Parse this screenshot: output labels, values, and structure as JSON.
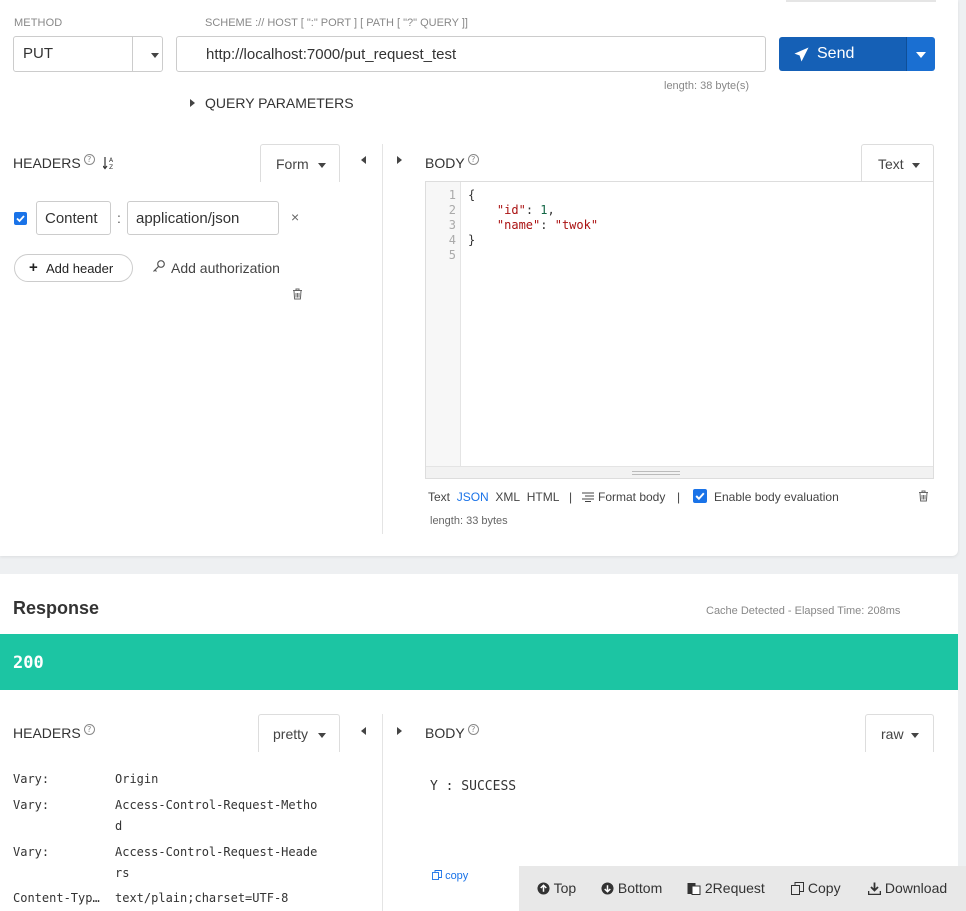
{
  "request": {
    "method_label": "METHOD",
    "method_value": "PUT",
    "scheme_label": "SCHEME :// HOST [ \":\" PORT ] [ PATH [ \"?\" QUERY ]]",
    "url": "http://localhost:7000/put_request_test",
    "url_length": "length: 38 byte(s)",
    "send_label": "Send",
    "query_params_label": "QUERY PARAMETERS",
    "headers": {
      "title": "HEADERS",
      "mode": "Form",
      "rows": [
        {
          "enabled": true,
          "name": "Content",
          "value": "application/json"
        }
      ],
      "add_header_label": "Add header",
      "add_authorization_label": "Add authorization"
    },
    "body": {
      "title": "BODY",
      "mode": "Text",
      "lines": [
        "{",
        "    \"id\": 1,",
        "    \"name\": \"twok\"",
        "}",
        ""
      ],
      "formats": [
        "Text",
        "JSON",
        "XML",
        "HTML"
      ],
      "active_format": "JSON",
      "format_body_label": "Format body",
      "enable_eval_label": "Enable body evaluation",
      "enable_eval_checked": true,
      "length": "length: 33 bytes"
    }
  },
  "response": {
    "title": "Response",
    "cache_note": "Cache Detected - Elapsed Time: 208ms",
    "status_code": "200",
    "status_color": "#1cc5a3",
    "headers_title": "HEADERS",
    "headers_mode": "pretty",
    "header_rows": [
      {
        "name": "Vary:",
        "value_lines": [
          "Origin"
        ]
      },
      {
        "name": "Vary:",
        "value_lines": [
          "Access-Control-Request-Metho",
          "d"
        ]
      },
      {
        "name": "Vary:",
        "value_lines": [
          "Access-Control-Request-Heade",
          "rs"
        ]
      },
      {
        "name": "Content-Typ…",
        "value_lines": [
          "text/plain;charset=UTF-8"
        ]
      }
    ],
    "body_title": "BODY",
    "body_mode": "raw",
    "body_text": "Y : SUCCESS",
    "copy_label": "copy"
  },
  "bottom_bar": {
    "top": "Top",
    "bottom": "Bottom",
    "to_request": "2Request",
    "copy": "Copy",
    "download": "Download"
  },
  "colors": {
    "primary": "#1560b6",
    "accent_link": "#1a73e8",
    "success": "#1cc5a3"
  }
}
